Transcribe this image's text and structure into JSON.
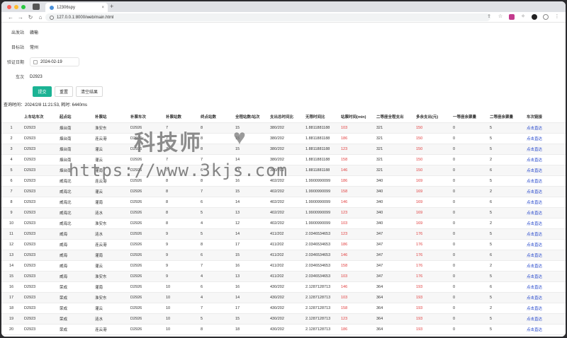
{
  "browser": {
    "tab_title": "12306spy",
    "tab_close": "×",
    "new_tab": "+",
    "url": "127.0.0.1:8000/web/main.html",
    "nav_back": "←",
    "nav_forward": "→",
    "nav_reload": "↻",
    "nav_home": "⌂"
  },
  "form": {
    "start_label": "出发站",
    "start_value": "赣榆",
    "dest_label": "目标站",
    "dest_value": "常州",
    "date_label": "验证日期",
    "date_value": "2024-02-19",
    "train_label": "车次",
    "train_value": "D2923",
    "submit": "提交",
    "reset": "重置",
    "clear": "清空结果"
  },
  "query_meta": "查询时间：2024/2/8 11:21:53, 耗时: 6440ms",
  "table": {
    "headers": [
      "",
      "上车站车次",
      "起点站",
      "补票站",
      "补票车次",
      "补票站数",
      "终点站数",
      "全程站数/站次",
      "支出总时间比",
      "无限时间比",
      "站票时间(min)",
      "二等座全程支出",
      "多余支出(元)",
      "一等座余票量",
      "二等座余票量",
      "车次链接"
    ],
    "rows": [
      [
        "1",
        "D2923",
        "烟台南",
        "淮安东",
        "D2926",
        "7",
        "8",
        "15",
        "380/202",
        "1.8811881188",
        "103",
        "321",
        "150",
        "0",
        "5",
        "点击直达"
      ],
      [
        "2",
        "D2923",
        "烟台南",
        "连云港",
        "D2926",
        "7",
        "8",
        "15",
        "380/202",
        "1.8811881188",
        "186",
        "321",
        "150",
        "0",
        "5",
        "点击直达"
      ],
      [
        "3",
        "D2923",
        "烟台南",
        "灌云",
        "D2926",
        "7",
        "8",
        "15",
        "380/202",
        "1.8811881188",
        "123",
        "321",
        "150",
        "0",
        "5",
        "点击直达"
      ],
      [
        "4",
        "D2923",
        "烟台南",
        "灌云",
        "D2926",
        "7",
        "7",
        "14",
        "380/202",
        "1.8811881188",
        "158",
        "321",
        "150",
        "0",
        "2",
        "点击直达"
      ],
      [
        "5",
        "D2923",
        "烟台南",
        "灌南",
        "D2926",
        "7",
        "6",
        "13",
        "380/202",
        "1.8811881188",
        "146",
        "321",
        "150",
        "0",
        "6",
        "点击直达"
      ],
      [
        "6",
        "D2923",
        "威海北",
        "连云港",
        "D2926",
        "8",
        "8",
        "16",
        "402/202",
        "1.9900990099",
        "186",
        "340",
        "169",
        "0",
        "5",
        "点击直达"
      ],
      [
        "7",
        "D2923",
        "威海北",
        "灌云",
        "D2926",
        "8",
        "7",
        "15",
        "402/202",
        "1.9900990099",
        "158",
        "340",
        "169",
        "0",
        "2",
        "点击直达"
      ],
      [
        "8",
        "D2923",
        "威海北",
        "灌南",
        "D2926",
        "8",
        "6",
        "14",
        "402/202",
        "1.9900990099",
        "146",
        "340",
        "169",
        "0",
        "6",
        "点击直达"
      ],
      [
        "9",
        "D2923",
        "威海北",
        "涟水",
        "D2926",
        "8",
        "5",
        "13",
        "402/202",
        "1.9900990099",
        "123",
        "340",
        "169",
        "0",
        "5",
        "点击直达"
      ],
      [
        "10",
        "D2923",
        "威海北",
        "淮安东",
        "D2926",
        "8",
        "4",
        "12",
        "402/202",
        "1.9900990099",
        "103",
        "340",
        "169",
        "0",
        "2",
        "点击直达"
      ],
      [
        "11",
        "D2923",
        "威海",
        "涟水",
        "D2926",
        "9",
        "5",
        "14",
        "411/202",
        "2.0346534653",
        "123",
        "347",
        "176",
        "0",
        "5",
        "点击直达"
      ],
      [
        "12",
        "D2923",
        "威海",
        "连云港",
        "D2926",
        "9",
        "8",
        "17",
        "411/202",
        "2.0346534653",
        "186",
        "347",
        "176",
        "0",
        "5",
        "点击直达"
      ],
      [
        "13",
        "D2923",
        "威海",
        "灌南",
        "D2926",
        "9",
        "6",
        "15",
        "411/202",
        "2.0346534653",
        "146",
        "347",
        "176",
        "0",
        "6",
        "点击直达"
      ],
      [
        "14",
        "D2923",
        "威海",
        "灌云",
        "D2926",
        "9",
        "7",
        "16",
        "411/202",
        "2.0346534653",
        "158",
        "347",
        "176",
        "0",
        "2",
        "点击直达"
      ],
      [
        "15",
        "D2923",
        "威海",
        "淮安东",
        "D2926",
        "9",
        "4",
        "13",
        "411/202",
        "2.0346534653",
        "103",
        "347",
        "176",
        "0",
        "5",
        "点击直达"
      ],
      [
        "16",
        "D2923",
        "荣成",
        "灌南",
        "D2926",
        "10",
        "6",
        "16",
        "430/202",
        "2.1287128713",
        "146",
        "364",
        "193",
        "0",
        "6",
        "点击直达"
      ],
      [
        "17",
        "D2923",
        "荣成",
        "淮安东",
        "D2926",
        "10",
        "4",
        "14",
        "430/202",
        "2.1287128713",
        "103",
        "364",
        "193",
        "0",
        "5",
        "点击直达"
      ],
      [
        "18",
        "D2923",
        "荣成",
        "灌云",
        "D2926",
        "10",
        "7",
        "17",
        "430/202",
        "2.1287128713",
        "158",
        "364",
        "193",
        "0",
        "2",
        "点击直达"
      ],
      [
        "19",
        "D2923",
        "荣成",
        "涟水",
        "D2926",
        "10",
        "5",
        "15",
        "430/202",
        "2.1287128713",
        "123",
        "364",
        "193",
        "0",
        "5",
        "点击直达"
      ],
      [
        "20",
        "D2923",
        "荣成",
        "连云港",
        "D2926",
        "10",
        "8",
        "18",
        "430/202",
        "2.1287128713",
        "186",
        "364",
        "193",
        "0",
        "5",
        "点击直达"
      ]
    ]
  },
  "watermark": {
    "title": "科技师",
    "url": "https://www.3kjs.com"
  },
  "colors": {
    "primary_button": "#1bb394",
    "red_text": "#e03a3a",
    "link": "#1a3ec9"
  }
}
